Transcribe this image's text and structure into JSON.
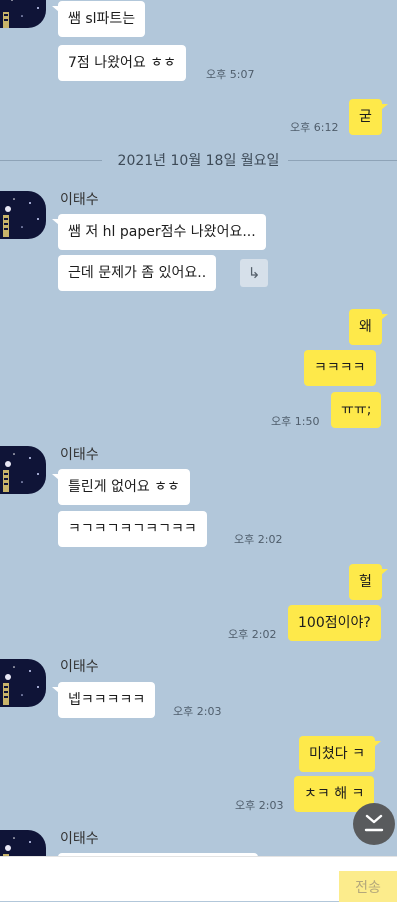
{
  "messages": {
    "m1": {
      "text": "쌤 sl파트는"
    },
    "m2": {
      "text": "7점 나왔어요 ㅎㅎ",
      "time": "오후 5:07"
    },
    "m3": {
      "text": "굳",
      "time": "오후 6:12"
    },
    "m4": {
      "sender": "이태수",
      "text": "쌤 저 hl paper점수 나왔어요..."
    },
    "m5": {
      "text": "근데 문제가 좀 있어요.."
    },
    "m6": {
      "text": "왜"
    },
    "m7": {
      "text": "ㅋㅋㅋㅋ"
    },
    "m8": {
      "text": "ㅠㅠ;",
      "time": "오후 1:50"
    },
    "m9": {
      "sender": "이태수",
      "text": "틀린게 없어요 ㅎㅎ"
    },
    "m10": {
      "text": "ㅋㄱㅋㄱㅋㄱㅋㄱㅋㅋ",
      "time": "오후 2:02"
    },
    "m11": {
      "text": "헐"
    },
    "m12": {
      "text": "100점이야?",
      "time": "오후 2:02"
    },
    "m13": {
      "sender": "이태수",
      "text": "넵ㅋㅋㅋㅋㅋ",
      "time": "오후 2:03"
    },
    "m14": {
      "text": "미쳤다 ㅋ"
    },
    "m15": {
      "text": "ㅊㅋ 해 ㅋ",
      "time": "오후 2:03"
    },
    "m16": {
      "sender": "이태수"
    }
  },
  "date_separator": "2021년 10월 18일 월요일",
  "input": {
    "value": "",
    "placeholder": ""
  },
  "send_label": "전송",
  "icons": {
    "forward": "share-forward-icon",
    "scroll": "chevron-double-down-icon"
  },
  "colors": {
    "background": "#b2c7da",
    "incoming_bubble": "#ffffff",
    "outgoing_bubble": "#fee94a",
    "send_button": "#fcec8c",
    "scroll_button": "#595b5d"
  }
}
